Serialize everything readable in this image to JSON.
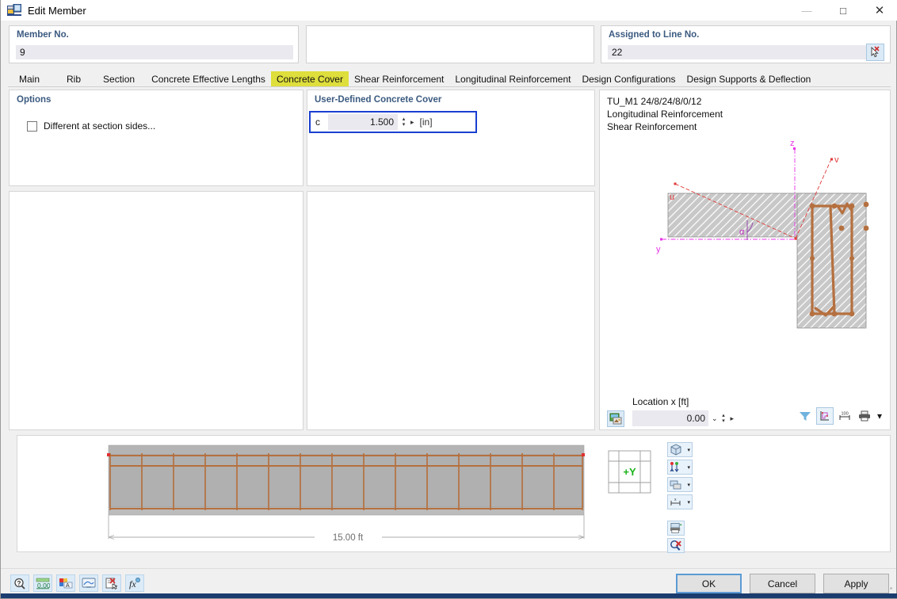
{
  "window": {
    "title": "Edit Member",
    "icon": "edit-member-icon",
    "minimize": "—",
    "maximize": "□",
    "close": "✕"
  },
  "header": {
    "member": {
      "label": "Member No.",
      "value": "9"
    },
    "middle": {
      "label": "",
      "value": ""
    },
    "line": {
      "label": "Assigned to Line No.",
      "value": "22",
      "pick_icon": "pick-cursor-icon"
    }
  },
  "tabs": [
    {
      "label": "Main",
      "active": false
    },
    {
      "label": "Rib",
      "active": false
    },
    {
      "label": "Section",
      "active": false
    },
    {
      "label": "Concrete Effective Lengths",
      "active": false
    },
    {
      "label": "Concrete Cover",
      "active": true
    },
    {
      "label": "Shear Reinforcement",
      "active": false
    },
    {
      "label": "Longitudinal Reinforcement",
      "active": false
    },
    {
      "label": "Design Configurations",
      "active": false
    },
    {
      "label": "Design Supports & Deflection",
      "active": false
    }
  ],
  "options_panel": {
    "title": "Options",
    "checkbox": {
      "label": "Different at section sides...",
      "checked": false
    }
  },
  "cover_panel": {
    "title": "User-Defined Concrete Cover",
    "field": {
      "name": "c",
      "value": "1.500",
      "unit": "[in]",
      "spin_up": "▴",
      "spin_down": "▾",
      "arrow": "▸"
    }
  },
  "graphic_panel": {
    "info_lines": [
      "TU_M1 24/8/24/8/0/12",
      "Longitudinal Reinforcement",
      "Shear Reinforcement"
    ],
    "location": {
      "label": "Location x [ft]",
      "value": "0.00",
      "dropdown_caret": "⌄",
      "spin_up": "▴",
      "spin_down": "▾",
      "arrow": "▸"
    },
    "tools": [
      {
        "name": "filter-icon"
      },
      {
        "name": "section-axes-icon",
        "framed": true
      },
      {
        "name": "dimension-icon"
      },
      {
        "name": "print-icon",
        "dropdown": "▾"
      }
    ],
    "section_labels": {
      "z": "z",
      "v": "v",
      "u": "u",
      "y": "y",
      "alpha": "α"
    }
  },
  "elevation_panel": {
    "dimension": "15.00 ft",
    "axis_label": "+Y",
    "tools": [
      {
        "name": "render-mode-icon",
        "dropdown": "▾"
      },
      {
        "name": "axis-display-icon",
        "dropdown": "▾"
      },
      {
        "name": "view-style-icon",
        "dropdown": "▾"
      },
      {
        "name": "dimension-style-icon",
        "dropdown": "▾"
      },
      {
        "name": "print-graphic-icon"
      },
      {
        "name": "zoom-reset-icon"
      }
    ]
  },
  "footer": {
    "tools": [
      {
        "name": "help-icon"
      },
      {
        "name": "units-icon"
      },
      {
        "name": "display-properties-icon"
      },
      {
        "name": "render-view-icon"
      },
      {
        "name": "clear-icon"
      },
      {
        "name": "formula-icon"
      }
    ],
    "buttons": [
      {
        "label": "OK",
        "primary": true
      },
      {
        "label": "Cancel",
        "primary": false
      },
      {
        "label": "Apply",
        "primary": false
      }
    ]
  },
  "colors": {
    "accent_blue": "#1a3fd0",
    "tab_highlight": "#dede3c",
    "panel_title": "#3b5a80",
    "rebar_brown": "#b5703f",
    "magenta_axis": "#e832e8",
    "red_axis": "#e23a3a",
    "status_bar": "#1b3c6e"
  }
}
